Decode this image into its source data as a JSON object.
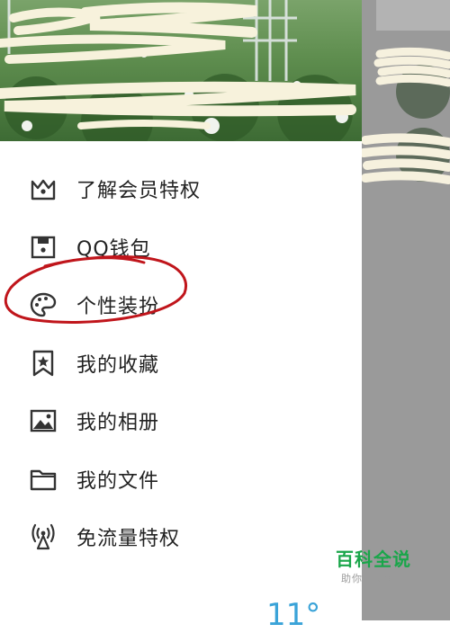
{
  "menu": {
    "items": [
      {
        "label": "了解会员特权",
        "icon": "crown-icon"
      },
      {
        "label": "QQ钱包",
        "icon": "wallet-icon"
      },
      {
        "label": "个性装扮",
        "icon": "palette-icon"
      },
      {
        "label": "我的收藏",
        "icon": "bookmark-star-icon"
      },
      {
        "label": "我的相册",
        "icon": "picture-icon"
      },
      {
        "label": "我的文件",
        "icon": "folder-icon"
      },
      {
        "label": "免流量特权",
        "icon": "signal-tower-icon"
      }
    ]
  },
  "annotation": {
    "color": "#c0151b"
  },
  "watermark": {
    "main": "百科全说",
    "sub": "助你轻松解决"
  },
  "weather": {
    "temp": "11°"
  },
  "colors": {
    "icon": "#333333",
    "text": "#222222",
    "overlay": "#9a9a9a",
    "watermark": "#1aa64a"
  }
}
